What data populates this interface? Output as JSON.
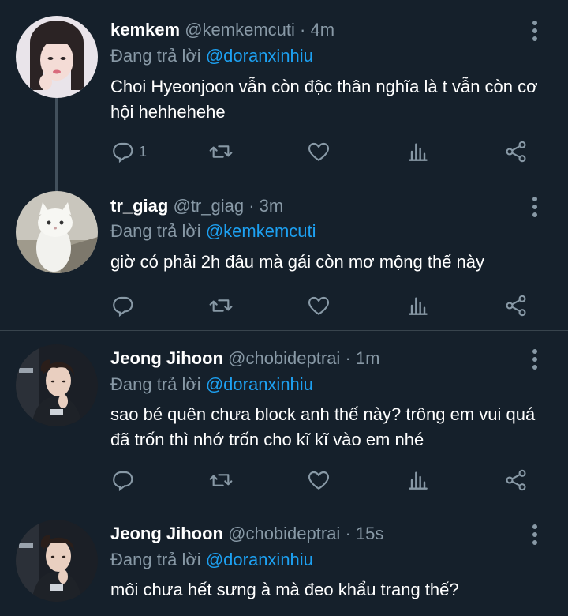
{
  "tweets": [
    {
      "name": "kemkem",
      "handle": "@kemkemcuti",
      "time": "4m",
      "reply_prefix": "Đang trả lời",
      "reply_to": "@doranxinhiu",
      "text": "Choi Hyeonjoon vẫn còn độc thân nghĩa là t vẫn còn cơ hội hehhehehe",
      "reply_count": "1",
      "avatar": "woman-portrait"
    },
    {
      "name": "tr_giag",
      "handle": "@tr_giag",
      "time": "3m",
      "reply_prefix": "Đang trả lời",
      "reply_to": "@kemkemcuti",
      "text": "giờ có phải 2h đâu mà gái còn mơ mộng thế này",
      "reply_count": "",
      "avatar": "white-cat"
    },
    {
      "name": "Jeong Jihoon",
      "handle": "@chobideptrai",
      "time": "1m",
      "reply_prefix": "Đang trả lời",
      "reply_to": "@doranxinhiu",
      "text": "sao bé quên chưa block anh thế này? trông em vui quá đã trốn thì nhớ trốn cho kĩ kĩ vào em nhé",
      "reply_count": "",
      "avatar": "gamer-portrait"
    },
    {
      "name": "Jeong Jihoon",
      "handle": "@chobideptrai",
      "time": "15s",
      "reply_prefix": "Đang trả lời",
      "reply_to": "@doranxinhiu",
      "text": "môi chưa hết sưng à mà đeo khẩu trang thế?",
      "reply_count": "",
      "avatar": "gamer-portrait"
    }
  ],
  "separator_dot": "·",
  "colors": {
    "background": "#15202b",
    "text": "#ffffff",
    "secondary": "#8899a6",
    "link": "#1da1f2",
    "divider": "#38444d"
  },
  "icons": [
    "reply-icon",
    "retweet-icon",
    "like-icon",
    "analytics-icon",
    "share-icon",
    "more-options-icon"
  ]
}
